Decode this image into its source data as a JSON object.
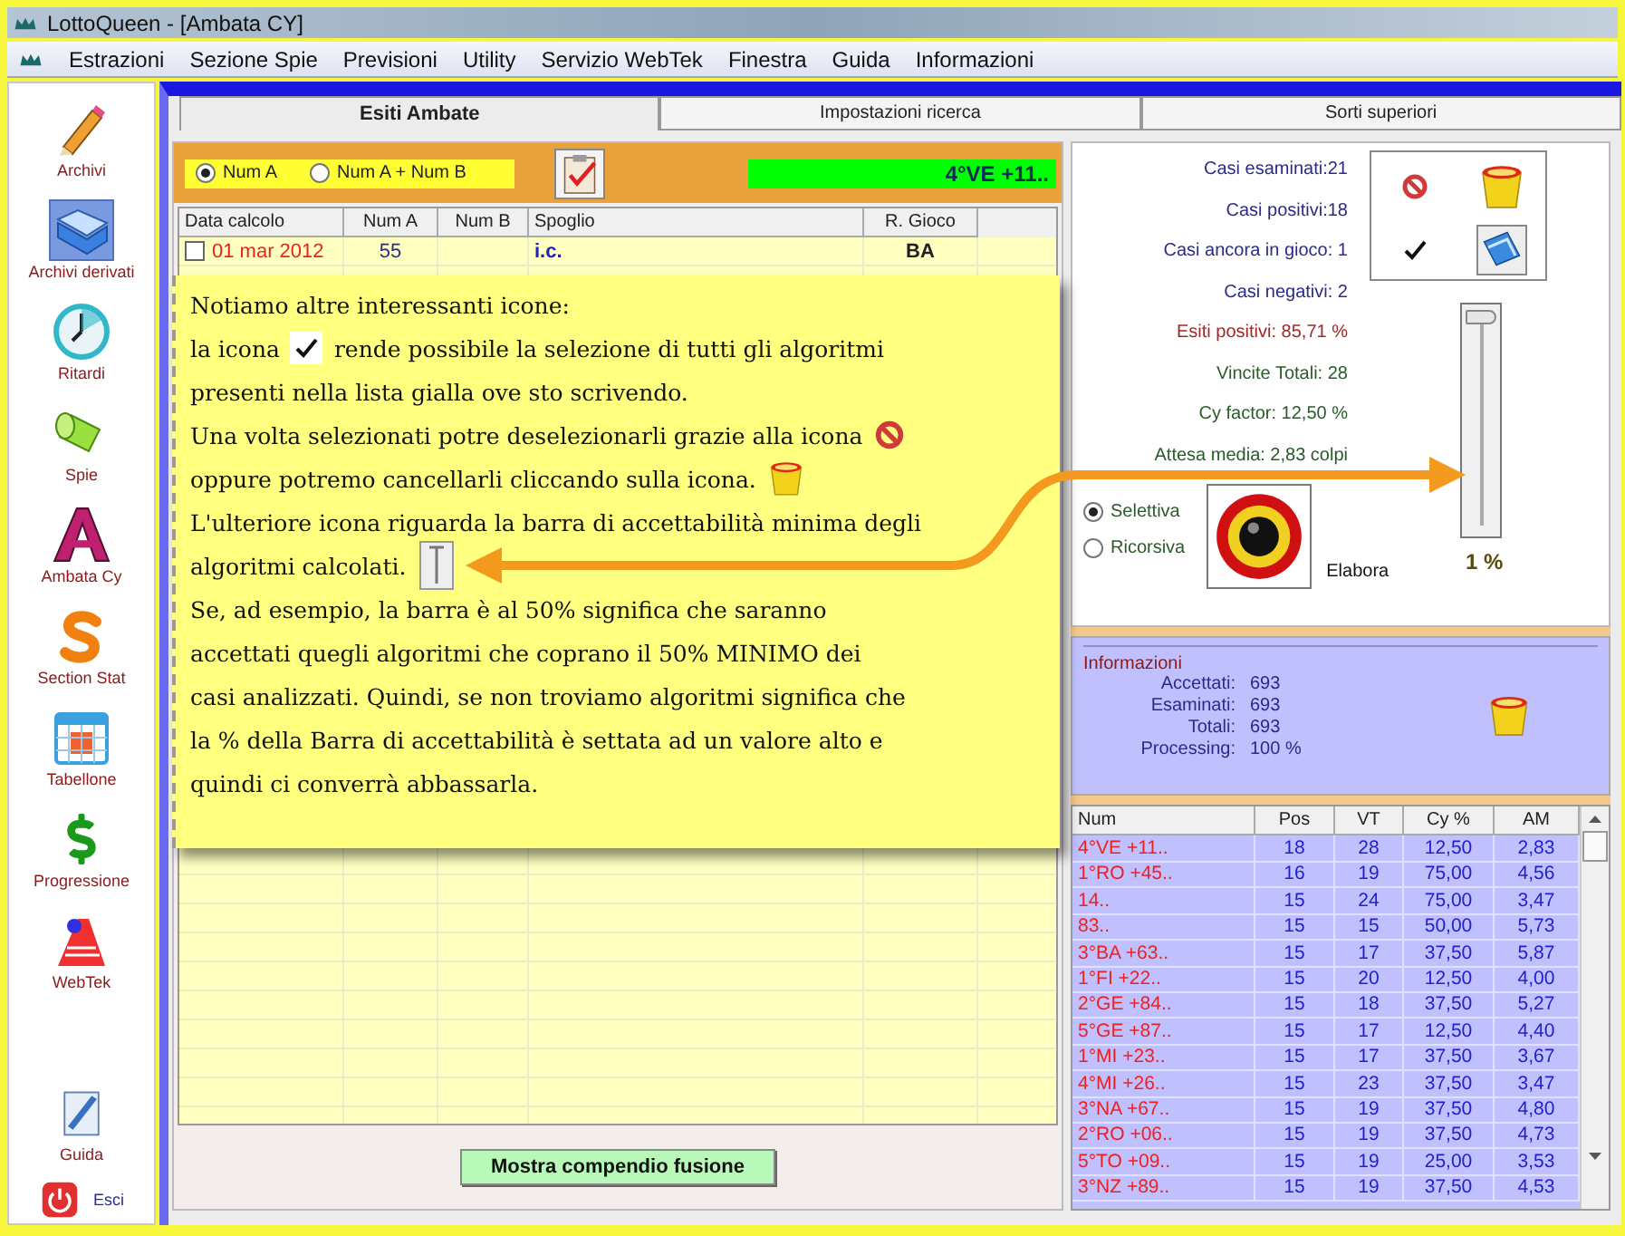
{
  "window": {
    "title": "LottoQueen - [Ambata CY]"
  },
  "menu": [
    "Estrazioni",
    "Sezione Spie",
    "Previsioni",
    "Utility",
    "Servizio WebTek",
    "Finestra",
    "Guida",
    "Informazioni"
  ],
  "sidebar": {
    "items": [
      {
        "label": "Archivi",
        "kind": "pencil",
        "selected": false
      },
      {
        "label": "Archivi derivati",
        "kind": "folder",
        "selected": true
      },
      {
        "label": "Ritardi",
        "kind": "clock",
        "selected": false
      },
      {
        "label": "Spie",
        "kind": "flashlight",
        "selected": false
      },
      {
        "label": "Ambata Cy",
        "kind": "letter",
        "selected": false
      },
      {
        "label": "Section Stat",
        "kind": "curve",
        "selected": false
      },
      {
        "label": "Tabellone",
        "kind": "calendar",
        "selected": false
      },
      {
        "label": "Progressione",
        "kind": "dollar",
        "selected": false
      },
      {
        "label": "WebTek",
        "kind": "webtek",
        "selected": false
      }
    ],
    "bottom_items": [
      {
        "label": "Guida",
        "kind": "document",
        "selected": false
      },
      {
        "label": "Esci",
        "kind": "power",
        "selected": false
      }
    ]
  },
  "tabs": [
    {
      "label": "Esiti Ambate",
      "selected": true
    },
    {
      "label": "Impostazioni ricerca",
      "selected": false
    },
    {
      "label": "Sorti superiori",
      "selected": false
    }
  ],
  "ambate": {
    "modes": [
      {
        "label": "Num A",
        "selected": true
      },
      {
        "label": "Num A + Num B",
        "selected": false
      }
    ],
    "status": "4°VE +11..",
    "columns": [
      "Data calcolo",
      "Num A",
      "Num B",
      "Spoglio",
      "R. Gioco"
    ],
    "rows": [
      {
        "checked": false,
        "date": "01 mar 2012",
        "num_a": "55",
        "spoglio": "i.c.",
        "r_gioco": "BA"
      }
    ],
    "button": "Mostra compendio fusione"
  },
  "stats": [
    {
      "text": "Casi esaminati:21",
      "color": "#2a2a8a"
    },
    {
      "text": "Casi positivi:18",
      "color": "#2a2a8a"
    },
    {
      "text": "Casi ancora in gioco: 1",
      "color": "#2a2a8a"
    },
    {
      "text": "Casi negativi: 2",
      "color": "#2a2a8a"
    },
    {
      "text": "Esiti positivi: 85,71 %",
      "color": "#a02828"
    },
    {
      "text": "Vincite Totali: 28",
      "color": "#2a5a2a"
    },
    {
      "text": "Cy factor: 12,50 %",
      "color": "#2a5a2a"
    },
    {
      "text": "Attesa media: 2,83 colpi",
      "color": "#2a5a2a"
    }
  ],
  "methods": [
    {
      "label": "Selettiva",
      "selected": true
    },
    {
      "label": "Ricorsiva",
      "selected": false
    }
  ],
  "elabora": "Elabora",
  "slider": {
    "level": 0.01,
    "reading": "1 %"
  },
  "info": {
    "title": "Informazioni",
    "rows": [
      {
        "label": "Accettati:",
        "value": "693"
      },
      {
        "label": "Esaminati:",
        "value": "693"
      },
      {
        "label": "Totali:",
        "value": "693"
      },
      {
        "label": "Processing:",
        "value": "100 %"
      }
    ]
  },
  "results": {
    "columns": [
      "Num",
      "Pos",
      "VT",
      "Cy %",
      "AM"
    ],
    "rows": [
      [
        "4°VE +11..",
        "18",
        "28",
        "12,50",
        "2,83"
      ],
      [
        "1°RO +45..",
        "16",
        "19",
        "75,00",
        "4,56"
      ],
      [
        "14..",
        "15",
        "24",
        "75,00",
        "3,47"
      ],
      [
        "83..",
        "15",
        "15",
        "50,00",
        "5,73"
      ],
      [
        "3°BA +63..",
        "15",
        "17",
        "37,50",
        "5,87"
      ],
      [
        "1°FI +22..",
        "15",
        "20",
        "12,50",
        "4,00"
      ],
      [
        "2°GE +84..",
        "15",
        "18",
        "37,50",
        "5,27"
      ],
      [
        "5°GE +87..",
        "15",
        "17",
        "12,50",
        "4,40"
      ],
      [
        "1°MI +23..",
        "15",
        "17",
        "37,50",
        "3,67"
      ],
      [
        "4°MI +26..",
        "15",
        "23",
        "37,50",
        "3,47"
      ],
      [
        "3°NA +67..",
        "15",
        "19",
        "37,50",
        "4,80"
      ],
      [
        "2°RO +06..",
        "15",
        "19",
        "37,50",
        "4,73"
      ],
      [
        "5°TO +09..",
        "15",
        "19",
        "25,00",
        "3,53"
      ],
      [
        "3°NZ +89..",
        "15",
        "19",
        "37,50",
        "4,53"
      ]
    ]
  },
  "note": {
    "lines": [
      [
        {
          "kind": "text",
          "text": "Notiamo altre interessanti icone:"
        }
      ],
      [
        {
          "kind": "text",
          "text": "la icona"
        },
        {
          "kind": "check"
        },
        {
          "kind": "text",
          "text": "rende possibile la selezione di tutti gli algoritmi"
        }
      ],
      [
        {
          "kind": "text",
          "text": "presenti nella lista gialla ove sto scrivendo."
        }
      ],
      [
        {
          "kind": "text",
          "text": "Una volta selezionati potre deselezionarli grazie alla icona"
        },
        {
          "kind": "no-entry"
        }
      ],
      [
        {
          "kind": "text",
          "text": "oppure potremo cancellarli cliccando sulla icona."
        },
        {
          "kind": "bucket"
        }
      ],
      [
        {
          "kind": "text",
          "text": "L'ulteriore icona riguarda la barra di accettabilità minima degli"
        }
      ],
      [
        {
          "kind": "text",
          "text": "algoritmi calcolati."
        },
        {
          "kind": "slider"
        }
      ],
      [
        {
          "kind": "text",
          "text": "Se, ad esempio, la barra è al 50% significa che saranno"
        }
      ],
      [
        {
          "kind": "text",
          "text": "accettati quegli algoritmi che coprano il 50% MINIMO dei"
        }
      ],
      [
        {
          "kind": "text",
          "text": "casi analizzati. Quindi, se non troviamo algoritmi significa che"
        }
      ],
      [
        {
          "kind": "text",
          "text": "la % della Barra di accettabilità è settata ad un valore alto e"
        }
      ],
      [
        {
          "kind": "text",
          "text": "quindi ci converrà abbassarla."
        }
      ]
    ]
  }
}
